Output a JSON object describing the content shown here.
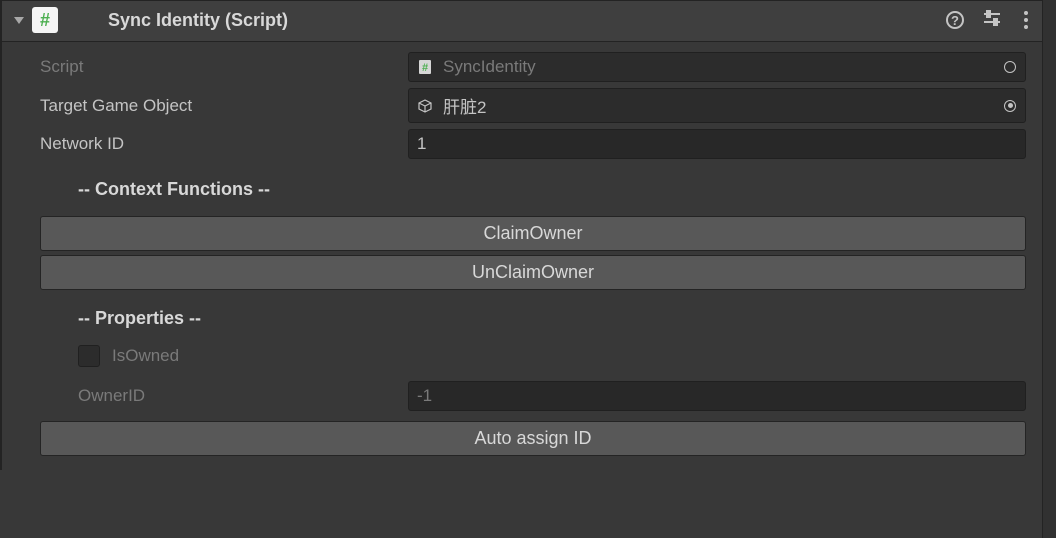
{
  "header": {
    "title": "Sync Identity (Script)"
  },
  "fields": {
    "script_label": "Script",
    "script_value": "SyncIdentity",
    "target_label": "Target Game Object",
    "target_value": "肝脏2",
    "network_id_label": "Network ID",
    "network_id_value": "1"
  },
  "context_functions": {
    "title": "-- Context Functions --",
    "buttons": [
      "ClaimOwner",
      "UnClaimOwner"
    ]
  },
  "properties": {
    "title": "-- Properties --",
    "is_owned_label": "IsOwned",
    "is_owned_checked": false,
    "owner_id_label": "OwnerID",
    "owner_id_value": "-1"
  },
  "footer": {
    "auto_assign_label": "Auto assign ID"
  }
}
